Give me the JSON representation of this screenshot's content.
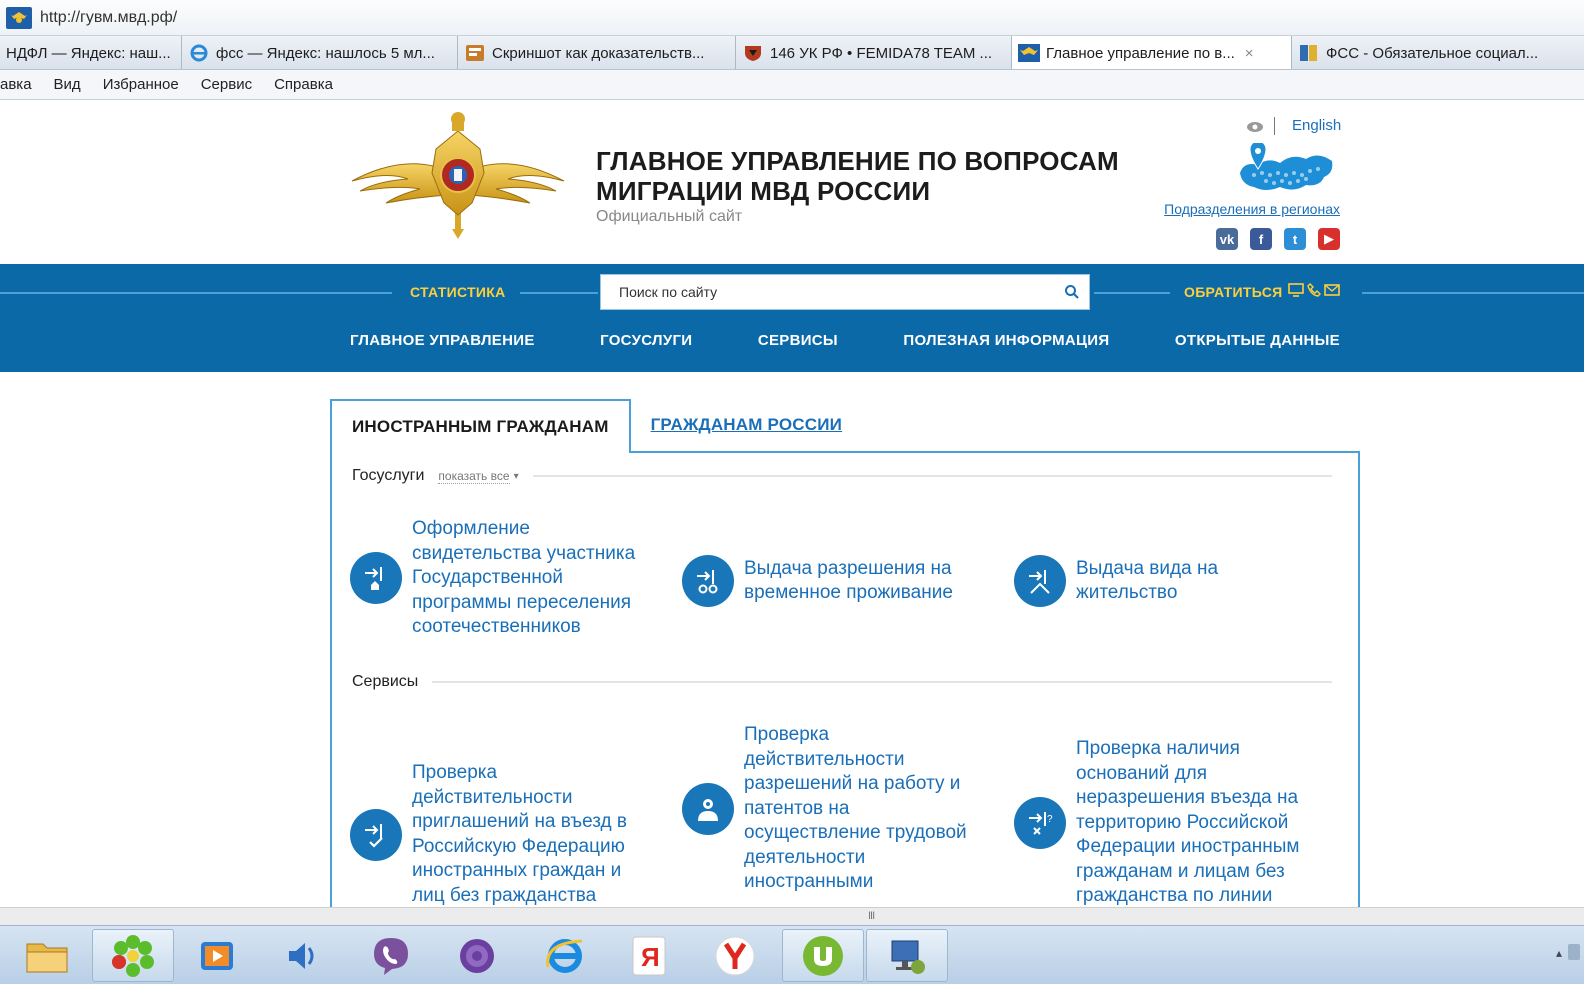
{
  "browser": {
    "url": "http://гувм.мвд.рф/",
    "tabs": [
      {
        "label": "НДФЛ — Яндекс: наш...",
        "icon": "yandex-icon",
        "active": false
      },
      {
        "label": "фсс — Яндекс: нашлось 5 мл...",
        "icon": "ie-icon",
        "active": false
      },
      {
        "label": "Скриншот как доказательств...",
        "icon": "site-icon",
        "active": false
      },
      {
        "label": "146 УК РФ • FEMIDA78 TEAM ...",
        "icon": "shield-icon",
        "active": false
      },
      {
        "label": "Главное управление по в...",
        "icon": "emblem-icon",
        "active": true
      },
      {
        "label": "ФСС - Обязательное социал...",
        "icon": "fss-icon",
        "active": false
      }
    ],
    "close_glyph": "×",
    "menu": [
      "авка",
      "Вид",
      "Избранное",
      "Сервис",
      "Справка"
    ]
  },
  "header": {
    "title_line1": "ГЛАВНОЕ УПРАВЛЕНИЕ ПО ВОПРОСАМ",
    "title_line2": "МИГРАЦИИ МВД РОССИИ",
    "subtitle": "Официальный сайт",
    "english": "English",
    "regions": "Подразделения в регионах",
    "socials": [
      {
        "name": "vk-icon",
        "glyph": "vk",
        "color": "#4a6c9b"
      },
      {
        "name": "facebook-icon",
        "glyph": "f",
        "color": "#3b5a9a"
      },
      {
        "name": "twitter-icon",
        "glyph": "t",
        "color": "#2c8fd6"
      },
      {
        "name": "youtube-icon",
        "glyph": "▶",
        "color": "#d8302c"
      }
    ]
  },
  "nav": {
    "statistics": "СТАТИСТИКА",
    "search_placeholder": "Поиск по сайту",
    "contact": "ОБРАТИТЬСЯ",
    "items": [
      "ГЛАВНОЕ УПРАВЛЕНИЕ",
      "ГОСУСЛУГИ",
      "СЕРВИСЫ",
      "ПОЛЕЗНАЯ ИНФОРМАЦИЯ",
      "ОТКРЫТЫЕ ДАННЫЕ"
    ]
  },
  "content": {
    "tabs": [
      "ИНОСТРАННЫМ ГРАЖДАНАМ",
      "ГРАЖДАНАМ РОССИИ"
    ],
    "gosuslugi": {
      "title": "Госуслуги",
      "show_all": "показать все",
      "items": [
        "Оформление свидетельства участника Государственной программы переселения соотечественников",
        "Выдача разрешения на временное проживание",
        "Выдача вида на жительство"
      ]
    },
    "services": {
      "title": "Сервисы",
      "items": [
        "Проверка действительности приглашений на въезд в Российскую Федерацию иностранных граждан и лиц без гражданства",
        "Проверка действительности разрешений на работу и патентов на осуществление трудовой деятельности иностранными",
        "Проверка наличия оснований для неразрешения въезда на территорию Российской Федерации иностранным гражданам и лицам без гражданства по линии"
      ]
    }
  },
  "taskbar": {
    "scroll_grip": "III",
    "apps": [
      "explorer-icon",
      "icq-icon",
      "media-player-icon",
      "volume-icon",
      "viber-icon",
      "tor-icon",
      "internet-explorer-icon",
      "yandex-icon",
      "yandex-browser-icon",
      "utorrent-icon",
      "network-icon"
    ],
    "tray_arrow": "▴"
  }
}
